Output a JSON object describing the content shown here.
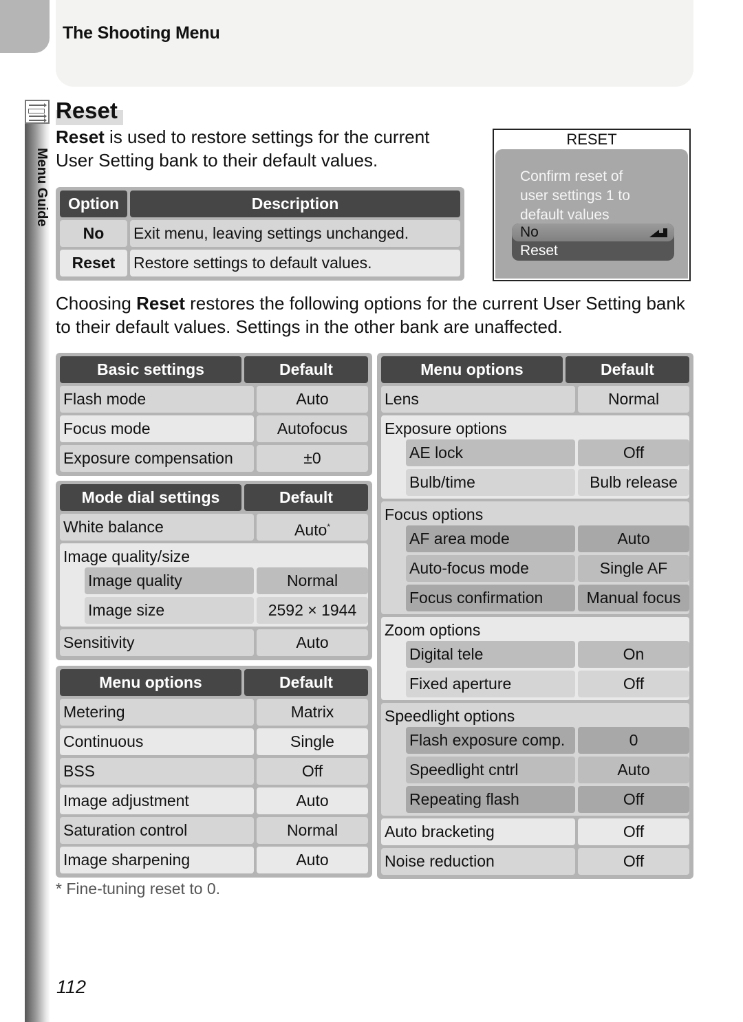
{
  "header": {
    "section_title": "The Shooting Menu"
  },
  "side_tab": {
    "label": "Menu Guide",
    "icon": "menu-list-icon"
  },
  "page": {
    "heading": "Reset",
    "intro_bold": "Reset",
    "intro_rest": " is used to restore settings for the current User Setting bank to their default values.",
    "para2_pre": "Choosing ",
    "para2_bold": "Reset",
    "para2_post": " restores the following options for the current User Setting bank to their default values.  Settings in the other bank are unaffected.",
    "footnote": "* Fine-tuning reset to 0.",
    "page_number": "112"
  },
  "option_table": {
    "headers": [
      "Option",
      "Description"
    ],
    "rows": [
      {
        "option": "No",
        "description": "Exit menu, leaving settings unchanged."
      },
      {
        "option": "Reset",
        "description": "Restore settings to default values."
      }
    ]
  },
  "lcd": {
    "title": "RESET",
    "message_lines": [
      "Confirm reset of",
      "user settings 1 to",
      "default values"
    ],
    "options": [
      "No",
      "Reset"
    ],
    "selected": "No",
    "enter_icon": "enter-icon"
  },
  "basic_settings": {
    "headers": [
      "Basic settings",
      "Default"
    ],
    "rows": [
      [
        "Flash mode",
        "Auto"
      ],
      [
        "Focus mode",
        "Autofocus"
      ],
      [
        "Exposure compensation",
        "±0"
      ]
    ]
  },
  "mode_dial_settings": {
    "headers": [
      "Mode dial settings",
      "Default"
    ],
    "white_balance": [
      "White balance",
      "Auto"
    ],
    "white_balance_note": "*",
    "image_group": {
      "title": "Image quality/size",
      "rows": [
        [
          "Image quality",
          "Normal"
        ],
        [
          "Image size",
          "2592 × 1944"
        ]
      ]
    },
    "sensitivity": [
      "Sensitivity",
      "Auto"
    ]
  },
  "menu_options_left": {
    "headers": [
      "Menu options",
      "Default"
    ],
    "rows": [
      [
        "Metering",
        "Matrix"
      ],
      [
        "Continuous",
        "Single"
      ],
      [
        "BSS",
        "Off"
      ],
      [
        "Image adjustment",
        "Auto"
      ],
      [
        "Saturation control",
        "Normal"
      ],
      [
        "Image sharpening",
        "Auto"
      ]
    ]
  },
  "menu_options_right": {
    "headers": [
      "Menu options",
      "Default"
    ],
    "lens": [
      "Lens",
      "Normal"
    ],
    "exposure_group": {
      "title": "Exposure options",
      "rows": [
        [
          "AE lock",
          "Off"
        ],
        [
          "Bulb/time",
          "Bulb release"
        ]
      ]
    },
    "focus_group": {
      "title": "Focus options",
      "rows": [
        [
          "AF area mode",
          "Auto"
        ],
        [
          "Auto-focus mode",
          "Single AF"
        ],
        [
          "Focus confirmation",
          "Manual focus"
        ]
      ]
    },
    "zoom_group": {
      "title": "Zoom options",
      "rows": [
        [
          "Digital tele",
          "On"
        ],
        [
          "Fixed aperture",
          "Off"
        ]
      ]
    },
    "speedlight_group": {
      "title": "Speedlight options",
      "rows": [
        [
          "Flash exposure comp.",
          "0"
        ],
        [
          "Speedlight cntrl",
          "Auto"
        ],
        [
          "Repeating flash",
          "Off"
        ]
      ]
    },
    "auto_bracketing": [
      "Auto bracketing",
      "Off"
    ],
    "noise_reduction": [
      "Noise reduction",
      "Off"
    ]
  }
}
